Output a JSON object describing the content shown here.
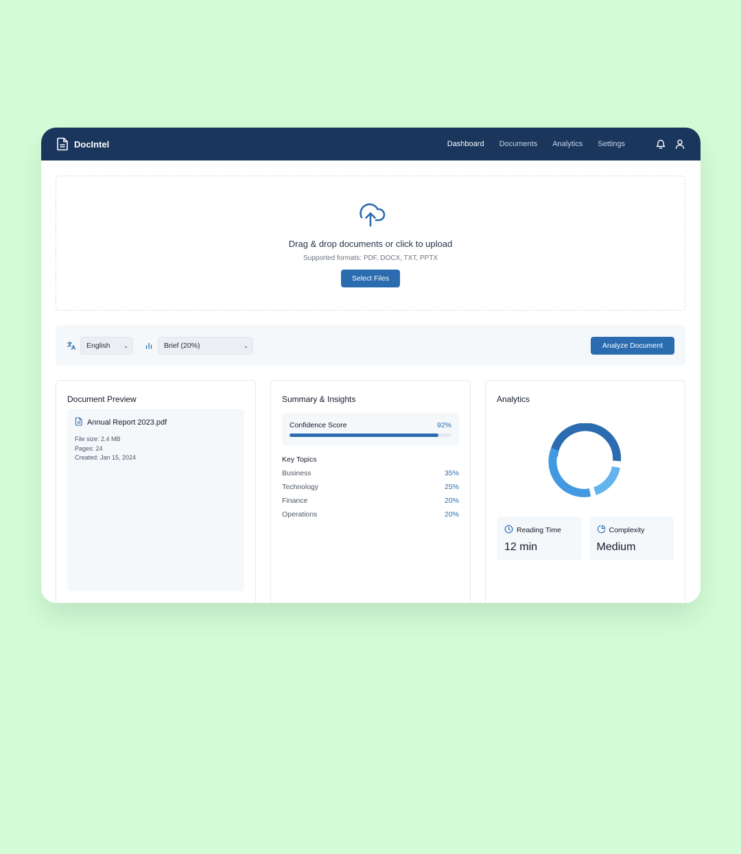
{
  "app": {
    "name": "DocIntel"
  },
  "nav": {
    "items": [
      {
        "label": "Dashboard",
        "active": true
      },
      {
        "label": "Documents",
        "active": false
      },
      {
        "label": "Analytics",
        "active": false
      },
      {
        "label": "Settings",
        "active": false
      }
    ],
    "icons": [
      "bell-icon",
      "user-icon"
    ]
  },
  "upload": {
    "icon": "cloud-upload-icon",
    "title": "Drag & drop documents or click to upload",
    "subtitle": "Supported formats: PDF, DOCX, TXT, PPTX",
    "button_label": "Select Files"
  },
  "options": {
    "language": {
      "icon": "translate-icon",
      "value": "English"
    },
    "summary_length": {
      "icon": "bar-chart-icon",
      "value": "Brief (20%)"
    },
    "analyze_label": "Analyze Document"
  },
  "preview": {
    "title": "Document Preview",
    "file_name": "Annual Report 2023.pdf",
    "file_size": "File size: 2.4 MB",
    "pages": "Pages: 24",
    "created": "Created: Jan 15, 2024"
  },
  "summary": {
    "title": "Summary & Insights",
    "confidence_label": "Confidence Score",
    "confidence_text": "92%",
    "confidence_value": 0.92,
    "topics_title": "Key Topics",
    "topics": [
      {
        "name": "Business",
        "value": "35%"
      },
      {
        "name": "Technology",
        "value": "25%"
      },
      {
        "name": "Finance",
        "value": "20%"
      },
      {
        "name": "Operations",
        "value": "20%"
      }
    ]
  },
  "analytics": {
    "title": "Analytics",
    "reading_time_label": "Reading Time",
    "reading_time_value": "12 min",
    "complexity_label": "Complexity",
    "complexity_value": "Medium"
  },
  "colors": {
    "header": "#1a365d",
    "accent": "#2b6cb0",
    "background": "#d3fdd7",
    "donut": [
      "#2b6cb0",
      "#63b3ed",
      "#4299e1"
    ]
  }
}
